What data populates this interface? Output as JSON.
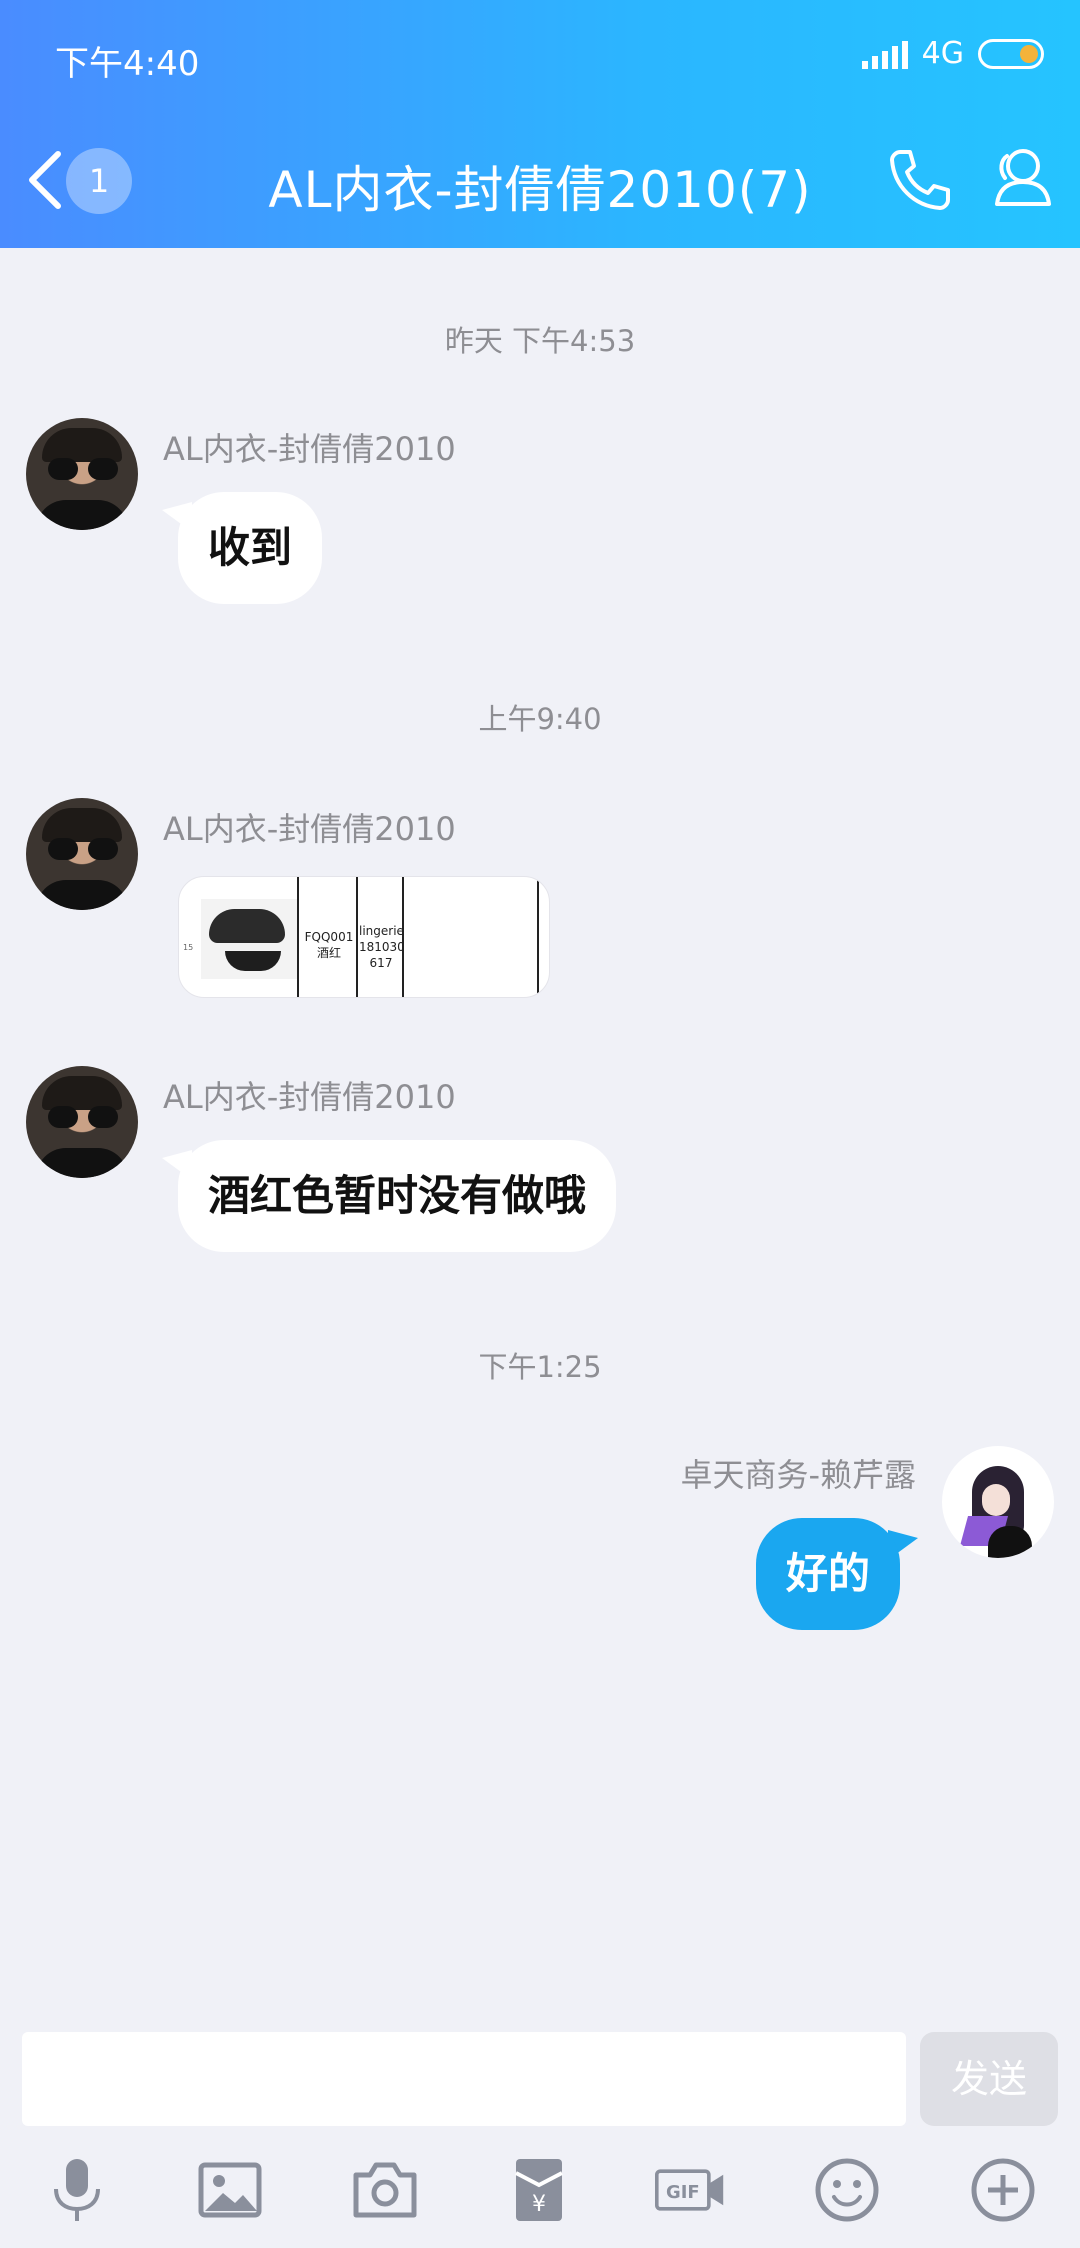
{
  "status_bar": {
    "time": "下午4:40",
    "network": "4G"
  },
  "header": {
    "back_badge": "1",
    "title": "AL内衣-封倩倩2010(7)"
  },
  "messages": [
    {
      "timestamp": "昨天 下午4:53",
      "sender": "AL内衣-封倩倩2010",
      "text": "收到"
    },
    {
      "timestamp": "上午9:40",
      "sender": "AL内衣-封倩倩2010",
      "image": {
        "code": "FQQ001",
        "color": "酒红",
        "label1": "lingerie",
        "label2": "181030",
        "label3": "617",
        "corner": "15"
      }
    },
    {
      "sender": "AL内衣-封倩倩2010",
      "text": "酒红色暂时没有做哦"
    },
    {
      "timestamp": "下午1:25",
      "sender": "卓天商务-赖芹露",
      "text": "好的"
    }
  ],
  "input": {
    "send_label": "发送"
  },
  "toolbar": [
    "mic-icon",
    "image-icon",
    "camera-icon",
    "red-packet-icon",
    "gif-icon",
    "emoji-icon",
    "plus-icon"
  ],
  "colors": {
    "header_start": "#4a8cff",
    "header_end": "#25c4ff",
    "self_bubble": "#1aa7f0",
    "background": "#f0f1f7"
  }
}
